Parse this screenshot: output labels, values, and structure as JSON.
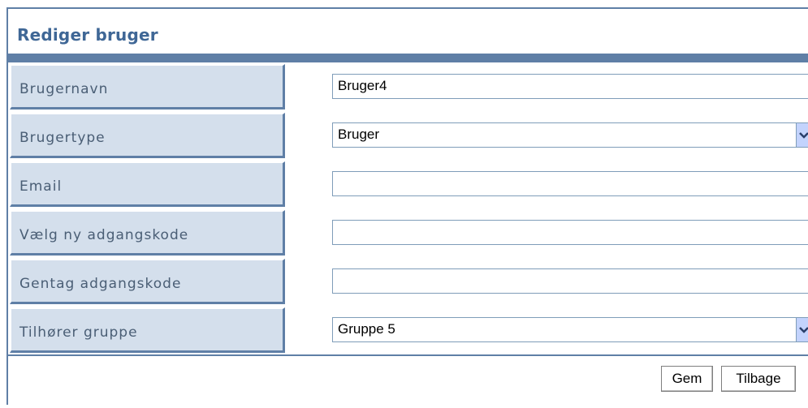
{
  "header": {
    "title": "Rediger bruger"
  },
  "form": {
    "rows": [
      {
        "label": "Brugernavn",
        "value": "Bruger4",
        "type": "text"
      },
      {
        "label": "Brugertype",
        "value": "Bruger",
        "type": "select"
      },
      {
        "label": "Email",
        "value": "",
        "type": "text"
      },
      {
        "label": "Vælg ny adgangskode",
        "value": "",
        "type": "password"
      },
      {
        "label": "Gentag adgangskode",
        "value": "",
        "type": "password"
      },
      {
        "label": "Tilhører gruppe",
        "value": "Gruppe 5",
        "type": "select"
      }
    ]
  },
  "actions": {
    "save_label": "Gem",
    "back_label": "Tilbage"
  },
  "colors": {
    "accent": "#5f7fa6",
    "title": "#3f6796",
    "label_bg": "#d4dfec",
    "label_text": "#4a5e75"
  }
}
